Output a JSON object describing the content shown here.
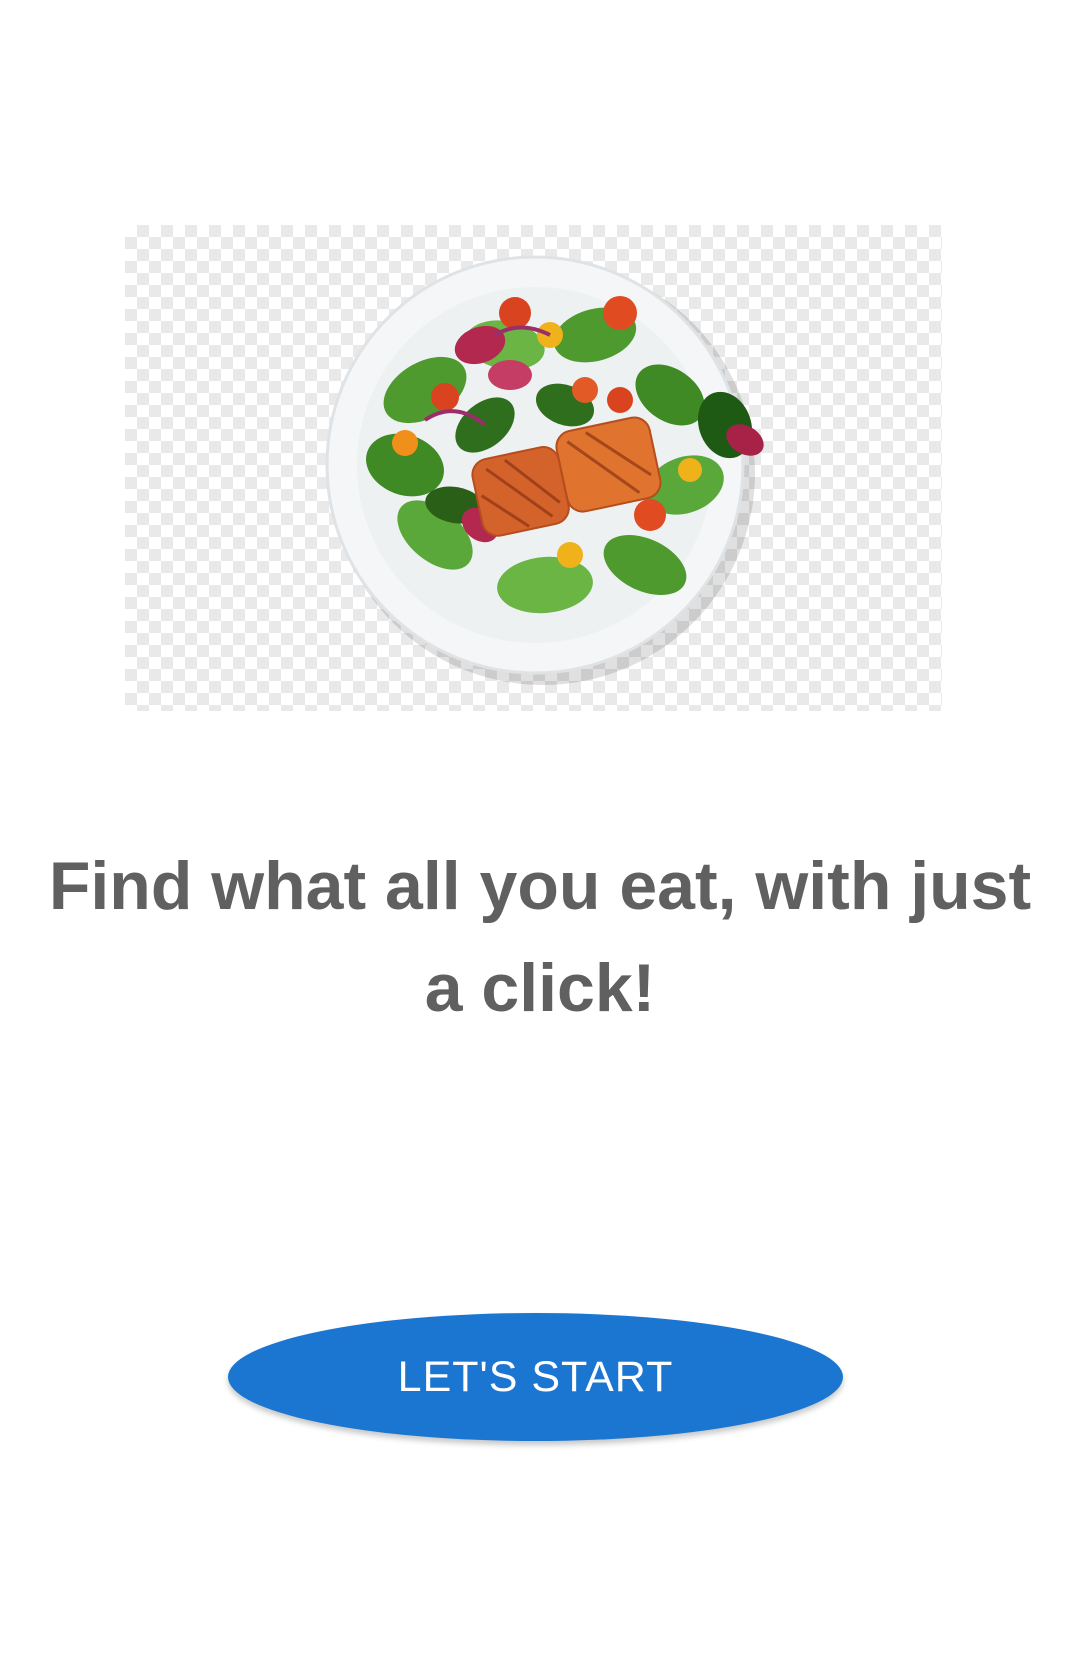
{
  "hero": {
    "image": "salmon-salad-plate",
    "background": "transparent-checkerboard"
  },
  "headline": {
    "text": "Find what all you eat, with just a click!"
  },
  "cta": {
    "label": "LET'S START",
    "color": "#1b76d2",
    "text_color": "#ffffff"
  },
  "colors": {
    "headline": "#606060",
    "background": "#ffffff"
  }
}
